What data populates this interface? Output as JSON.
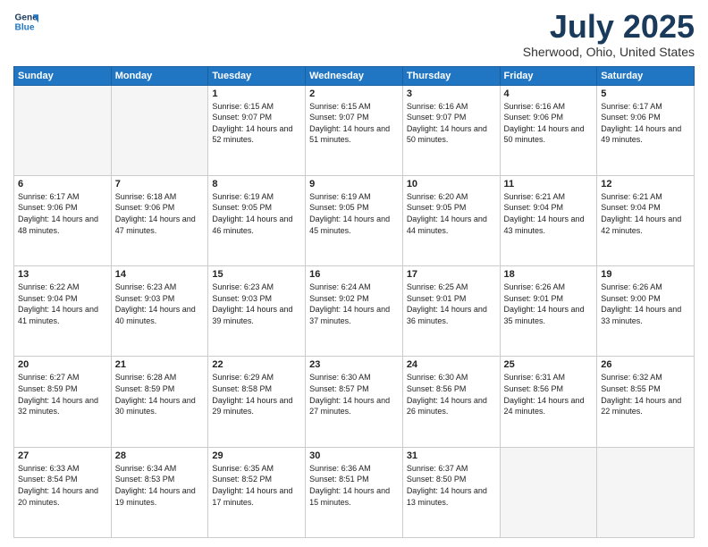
{
  "logo": {
    "line1": "General",
    "line2": "Blue"
  },
  "title": "July 2025",
  "location": "Sherwood, Ohio, United States",
  "headers": [
    "Sunday",
    "Monday",
    "Tuesday",
    "Wednesday",
    "Thursday",
    "Friday",
    "Saturday"
  ],
  "weeks": [
    [
      {
        "day": "",
        "sunrise": "",
        "sunset": "",
        "daylight": ""
      },
      {
        "day": "",
        "sunrise": "",
        "sunset": "",
        "daylight": ""
      },
      {
        "day": "1",
        "sunrise": "Sunrise: 6:15 AM",
        "sunset": "Sunset: 9:07 PM",
        "daylight": "Daylight: 14 hours and 52 minutes."
      },
      {
        "day": "2",
        "sunrise": "Sunrise: 6:15 AM",
        "sunset": "Sunset: 9:07 PM",
        "daylight": "Daylight: 14 hours and 51 minutes."
      },
      {
        "day": "3",
        "sunrise": "Sunrise: 6:16 AM",
        "sunset": "Sunset: 9:07 PM",
        "daylight": "Daylight: 14 hours and 50 minutes."
      },
      {
        "day": "4",
        "sunrise": "Sunrise: 6:16 AM",
        "sunset": "Sunset: 9:06 PM",
        "daylight": "Daylight: 14 hours and 50 minutes."
      },
      {
        "day": "5",
        "sunrise": "Sunrise: 6:17 AM",
        "sunset": "Sunset: 9:06 PM",
        "daylight": "Daylight: 14 hours and 49 minutes."
      }
    ],
    [
      {
        "day": "6",
        "sunrise": "Sunrise: 6:17 AM",
        "sunset": "Sunset: 9:06 PM",
        "daylight": "Daylight: 14 hours and 48 minutes."
      },
      {
        "day": "7",
        "sunrise": "Sunrise: 6:18 AM",
        "sunset": "Sunset: 9:06 PM",
        "daylight": "Daylight: 14 hours and 47 minutes."
      },
      {
        "day": "8",
        "sunrise": "Sunrise: 6:19 AM",
        "sunset": "Sunset: 9:05 PM",
        "daylight": "Daylight: 14 hours and 46 minutes."
      },
      {
        "day": "9",
        "sunrise": "Sunrise: 6:19 AM",
        "sunset": "Sunset: 9:05 PM",
        "daylight": "Daylight: 14 hours and 45 minutes."
      },
      {
        "day": "10",
        "sunrise": "Sunrise: 6:20 AM",
        "sunset": "Sunset: 9:05 PM",
        "daylight": "Daylight: 14 hours and 44 minutes."
      },
      {
        "day": "11",
        "sunrise": "Sunrise: 6:21 AM",
        "sunset": "Sunset: 9:04 PM",
        "daylight": "Daylight: 14 hours and 43 minutes."
      },
      {
        "day": "12",
        "sunrise": "Sunrise: 6:21 AM",
        "sunset": "Sunset: 9:04 PM",
        "daylight": "Daylight: 14 hours and 42 minutes."
      }
    ],
    [
      {
        "day": "13",
        "sunrise": "Sunrise: 6:22 AM",
        "sunset": "Sunset: 9:04 PM",
        "daylight": "Daylight: 14 hours and 41 minutes."
      },
      {
        "day": "14",
        "sunrise": "Sunrise: 6:23 AM",
        "sunset": "Sunset: 9:03 PM",
        "daylight": "Daylight: 14 hours and 40 minutes."
      },
      {
        "day": "15",
        "sunrise": "Sunrise: 6:23 AM",
        "sunset": "Sunset: 9:03 PM",
        "daylight": "Daylight: 14 hours and 39 minutes."
      },
      {
        "day": "16",
        "sunrise": "Sunrise: 6:24 AM",
        "sunset": "Sunset: 9:02 PM",
        "daylight": "Daylight: 14 hours and 37 minutes."
      },
      {
        "day": "17",
        "sunrise": "Sunrise: 6:25 AM",
        "sunset": "Sunset: 9:01 PM",
        "daylight": "Daylight: 14 hours and 36 minutes."
      },
      {
        "day": "18",
        "sunrise": "Sunrise: 6:26 AM",
        "sunset": "Sunset: 9:01 PM",
        "daylight": "Daylight: 14 hours and 35 minutes."
      },
      {
        "day": "19",
        "sunrise": "Sunrise: 6:26 AM",
        "sunset": "Sunset: 9:00 PM",
        "daylight": "Daylight: 14 hours and 33 minutes."
      }
    ],
    [
      {
        "day": "20",
        "sunrise": "Sunrise: 6:27 AM",
        "sunset": "Sunset: 8:59 PM",
        "daylight": "Daylight: 14 hours and 32 minutes."
      },
      {
        "day": "21",
        "sunrise": "Sunrise: 6:28 AM",
        "sunset": "Sunset: 8:59 PM",
        "daylight": "Daylight: 14 hours and 30 minutes."
      },
      {
        "day": "22",
        "sunrise": "Sunrise: 6:29 AM",
        "sunset": "Sunset: 8:58 PM",
        "daylight": "Daylight: 14 hours and 29 minutes."
      },
      {
        "day": "23",
        "sunrise": "Sunrise: 6:30 AM",
        "sunset": "Sunset: 8:57 PM",
        "daylight": "Daylight: 14 hours and 27 minutes."
      },
      {
        "day": "24",
        "sunrise": "Sunrise: 6:30 AM",
        "sunset": "Sunset: 8:56 PM",
        "daylight": "Daylight: 14 hours and 26 minutes."
      },
      {
        "day": "25",
        "sunrise": "Sunrise: 6:31 AM",
        "sunset": "Sunset: 8:56 PM",
        "daylight": "Daylight: 14 hours and 24 minutes."
      },
      {
        "day": "26",
        "sunrise": "Sunrise: 6:32 AM",
        "sunset": "Sunset: 8:55 PM",
        "daylight": "Daylight: 14 hours and 22 minutes."
      }
    ],
    [
      {
        "day": "27",
        "sunrise": "Sunrise: 6:33 AM",
        "sunset": "Sunset: 8:54 PM",
        "daylight": "Daylight: 14 hours and 20 minutes."
      },
      {
        "day": "28",
        "sunrise": "Sunrise: 6:34 AM",
        "sunset": "Sunset: 8:53 PM",
        "daylight": "Daylight: 14 hours and 19 minutes."
      },
      {
        "day": "29",
        "sunrise": "Sunrise: 6:35 AM",
        "sunset": "Sunset: 8:52 PM",
        "daylight": "Daylight: 14 hours and 17 minutes."
      },
      {
        "day": "30",
        "sunrise": "Sunrise: 6:36 AM",
        "sunset": "Sunset: 8:51 PM",
        "daylight": "Daylight: 14 hours and 15 minutes."
      },
      {
        "day": "31",
        "sunrise": "Sunrise: 6:37 AM",
        "sunset": "Sunset: 8:50 PM",
        "daylight": "Daylight: 14 hours and 13 minutes."
      },
      {
        "day": "",
        "sunrise": "",
        "sunset": "",
        "daylight": ""
      },
      {
        "day": "",
        "sunrise": "",
        "sunset": "",
        "daylight": ""
      }
    ]
  ]
}
